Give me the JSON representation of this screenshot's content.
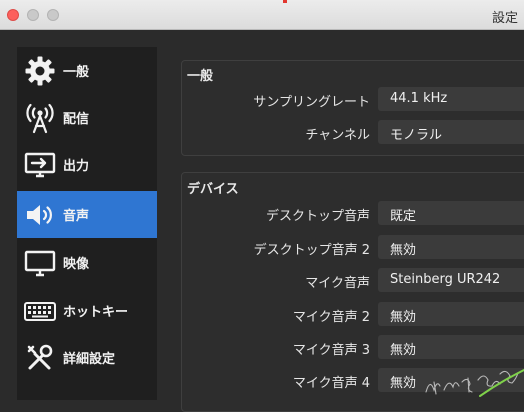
{
  "window": {
    "title": "設定"
  },
  "sidebar": {
    "items": [
      {
        "label": "一般",
        "icon": "gear-icon",
        "active": false
      },
      {
        "label": "配信",
        "icon": "broadcast-icon",
        "active": false
      },
      {
        "label": "出力",
        "icon": "output-icon",
        "active": false
      },
      {
        "label": "音声",
        "icon": "speaker-icon",
        "active": true
      },
      {
        "label": "映像",
        "icon": "monitor-icon",
        "active": false
      },
      {
        "label": "ホットキー",
        "icon": "keyboard-icon",
        "active": false
      },
      {
        "label": "詳細設定",
        "icon": "tools-icon",
        "active": false
      }
    ]
  },
  "general": {
    "title": "一般",
    "sample_rate_label": "サンプリングレート",
    "sample_rate_value": "44.1 kHz",
    "channels_label": "チャンネル",
    "channels_value": "モノラル"
  },
  "devices": {
    "title": "デバイス",
    "rows": [
      {
        "label": "デスクトップ音声",
        "value": "既定"
      },
      {
        "label": "デスクトップ音声 2",
        "value": "無効"
      },
      {
        "label": "マイク音声",
        "value": "Steinberg UR242"
      },
      {
        "label": "マイク音声 2",
        "value": "無効"
      },
      {
        "label": "マイク音声 3",
        "value": "無効"
      },
      {
        "label": "マイク音声 4",
        "value": "無効"
      }
    ]
  },
  "colors": {
    "accent": "#2f76d2",
    "close": "#fc605c"
  }
}
